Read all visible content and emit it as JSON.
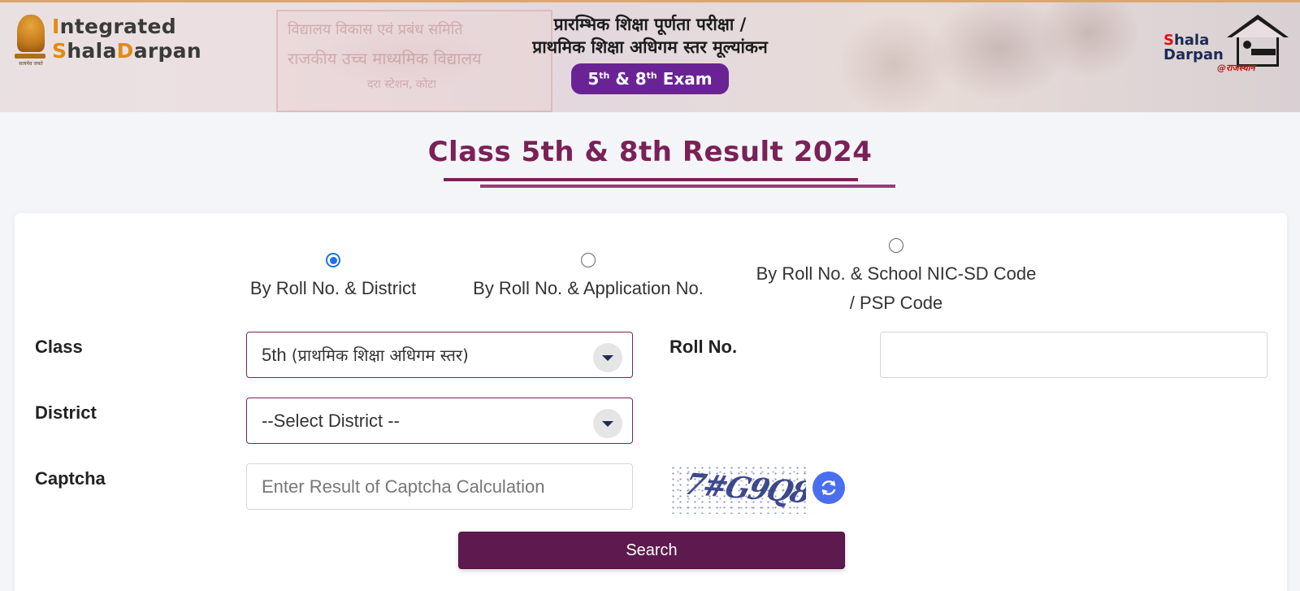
{
  "header": {
    "brand_line1_initial": "I",
    "brand_line1_rest": "ntegrated",
    "brand_line2_s": "S",
    "brand_line2_hala": "hala",
    "brand_line2_d": "D",
    "brand_line2_arpan": "arpan",
    "emblem_motto": "सत्यमेव जयते",
    "hindi_title_line1": "प्रारम्भिक शिक्षा पूर्णता परीक्षा /",
    "hindi_title_line2": "प्राथमिक शिक्षा अधिगम स्तर मूल्यांकन",
    "exam_pill": {
      "n1": "5",
      "sup1": "th",
      "amp": "&",
      "n2": "8",
      "sup2": "th",
      "word": "Exam"
    },
    "right_logo": {
      "s": "S",
      "hala": "hala",
      "d": "D",
      "arpan": "arpan",
      "tag": "@राजस्थान"
    }
  },
  "page_title": "Class 5th & 8th Result 2024",
  "search_mode": {
    "options": [
      {
        "label": "By Roll No. & District",
        "selected": true
      },
      {
        "label": "By Roll No. & Application No.",
        "selected": false
      },
      {
        "label_line1": "By Roll No. & School NIC-SD Code",
        "label_line2": "/ PSP Code",
        "selected": false
      }
    ]
  },
  "form": {
    "class_label": "Class",
    "class_value_prefix": "5th ",
    "class_value_hindi": "(प्राथमिक शिक्षा अधिगम स्तर)",
    "roll_label": "Roll No.",
    "roll_value": "",
    "district_label": "District",
    "district_value": "--Select District --",
    "captcha_label": "Captcha",
    "captcha_placeholder": "Enter Result of Captcha Calculation",
    "captcha_code": "7#G9Q8",
    "search_label": "Search"
  },
  "colors": {
    "accent": "#7a2158",
    "button": "#5e1a4e",
    "pill": "#6a2394",
    "refresh": "#4a6ef0",
    "radio_checked": "#1a73e8"
  },
  "icons": {
    "refresh": "refresh-icon",
    "select_caret": "chevron-down-icon",
    "emblem": "ashoka-emblem-icon",
    "house": "house-icon"
  }
}
